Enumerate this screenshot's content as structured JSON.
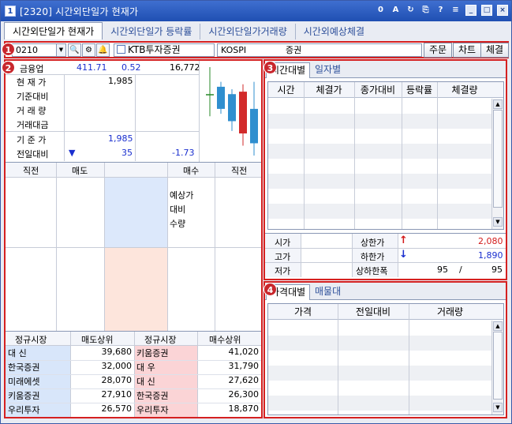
{
  "window": {
    "title": "[2320] 시간외단일가 현재가",
    "app_icon": "1",
    "tool_icons": [
      "0",
      "A",
      "↻",
      "⎘",
      "?",
      "≡"
    ]
  },
  "tabs": [
    {
      "label": "시간외단일가 현재가",
      "active": true
    },
    {
      "label": "시간외단일가 등락률",
      "active": false
    },
    {
      "label": "시간외단일가거래량",
      "active": false
    },
    {
      "label": "시간외예상체결",
      "active": false
    }
  ],
  "toolbar": {
    "code": "0210",
    "stock_name": "KTB투자증권",
    "market": "KOSPI",
    "sector": "증권",
    "order_button": "주문",
    "chart_button": "차트",
    "trade_button": "체결"
  },
  "badges": [
    "1",
    "2",
    "3",
    "4"
  ],
  "quote": {
    "industry_label": "금융업",
    "industry_value1": "411.71",
    "industry_value2": "0.52",
    "industry_value3": "16,772",
    "rows": [
      {
        "label": "현 재 가",
        "value": "1,985"
      },
      {
        "label": "기준대비",
        "value": ""
      },
      {
        "label": "거 래 량",
        "value": ""
      },
      {
        "label": "거래대금",
        "value": ""
      }
    ],
    "base_label": "기 준 가",
    "base_value": "1,985",
    "prev_label": "전일대비",
    "prev_arrow": "▼",
    "prev_value": "35",
    "prev_pct": "-1.73"
  },
  "candles": [
    {
      "o": 1985,
      "c": 1985,
      "h": 2040,
      "l": 1940,
      "color": "#2a8a2a"
    },
    {
      "o": 2000,
      "c": 1955,
      "h": 2010,
      "l": 1945,
      "color": "#2f8fcf"
    },
    {
      "o": 1930,
      "c": 1985,
      "h": 1995,
      "l": 1910,
      "color": "#2f8fcf"
    },
    {
      "o": 1905,
      "c": 1990,
      "h": 2005,
      "l": 1880,
      "color": "#d22a2a"
    },
    {
      "o": 1955,
      "c": 1885,
      "h": 2010,
      "l": 1860,
      "color": "#2f8fcf"
    }
  ],
  "orderbook": {
    "headers": [
      "직전",
      "매도",
      "",
      "매수",
      "직전"
    ],
    "expected_label_1": "예상가",
    "expected_label_2": "대비",
    "expected_label_3": "수량"
  },
  "brokers": {
    "headers": [
      "정규시장",
      "매도상위",
      "정규시장",
      "매수상위"
    ],
    "sell": [
      {
        "name": "대    신",
        "vol": "39,680"
      },
      {
        "name": "한국증권",
        "vol": "32,000"
      },
      {
        "name": "미래에셋",
        "vol": "28,070"
      },
      {
        "name": "키움증권",
        "vol": "27,910"
      },
      {
        "name": "우리투자",
        "vol": "26,570"
      }
    ],
    "buy": [
      {
        "name": "키움증권",
        "vol": "41,020"
      },
      {
        "name": "대    우",
        "vol": "31,790"
      },
      {
        "name": "대    신",
        "vol": "27,620"
      },
      {
        "name": "한국증권",
        "vol": "26,300"
      },
      {
        "name": "우리투자",
        "vol": "18,870"
      }
    ]
  },
  "trades_panel": {
    "tabs": [
      "시간대별",
      "일자별"
    ],
    "headers": [
      "시간",
      "체결가",
      "종가대비",
      "등락률",
      "체결량"
    ]
  },
  "ohlc": {
    "open_label": "시가",
    "high_label": "고가",
    "low_label": "저가",
    "upper_label": "상한가",
    "upper_value": "2,080",
    "lower_label": "하한가",
    "lower_value": "1,890",
    "range_label": "상하한폭",
    "range_value_1": "95",
    "range_sep": "/",
    "range_value_2": "95"
  },
  "volume_panel": {
    "tabs": [
      "가격대별",
      "매물대"
    ],
    "headers": [
      "가격",
      "전일대비",
      "거래량"
    ]
  }
}
